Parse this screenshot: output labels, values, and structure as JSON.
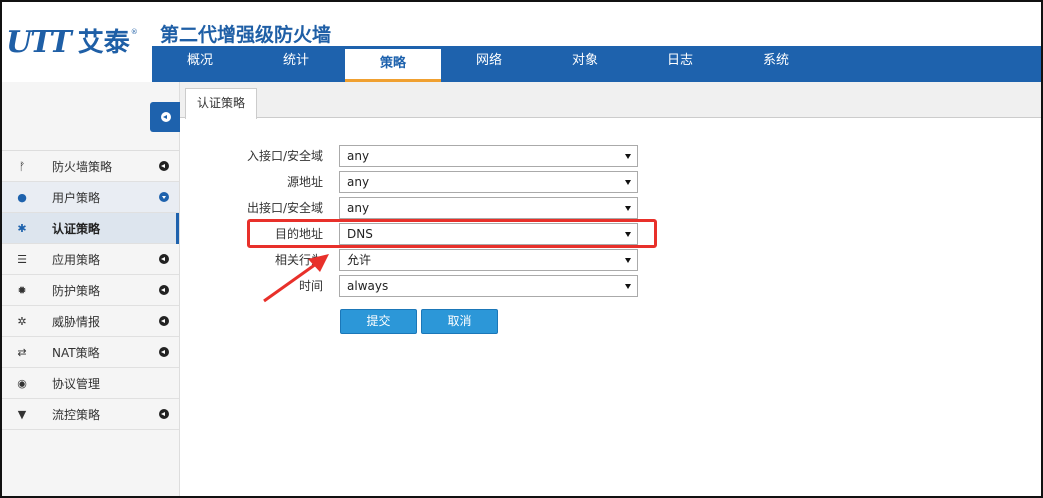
{
  "header": {
    "logo_mark": "UTT",
    "logo_text": "艾泰",
    "logo_reg": "®",
    "product_title": "第二代增强级防火墙"
  },
  "top_nav": {
    "tabs": [
      {
        "label": "概况"
      },
      {
        "label": "统计"
      },
      {
        "label": "策略"
      },
      {
        "label": "网络"
      },
      {
        "label": "对象"
      },
      {
        "label": "日志"
      },
      {
        "label": "系统"
      }
    ],
    "active": "策略"
  },
  "sidebar": {
    "collapse_icon": "chevron-left-circle-icon",
    "items": [
      {
        "label": "防火墙策略",
        "icon": "firewall-icon"
      },
      {
        "label": "用户策略",
        "icon": "users-icon"
      },
      {
        "label": "认证策略",
        "icon": "gear-icon"
      },
      {
        "label": "应用策略",
        "icon": "list-icon"
      },
      {
        "label": "防护策略",
        "icon": "shield-icon"
      },
      {
        "label": "威胁情报",
        "icon": "bug-icon"
      },
      {
        "label": "NAT策略",
        "icon": "exchange-icon"
      },
      {
        "label": "协议管理",
        "icon": "globe-icon"
      },
      {
        "label": "流控策略",
        "icon": "filter-icon"
      }
    ],
    "selected": "认证策略"
  },
  "content": {
    "tab_label": "认证策略",
    "form": {
      "fields": [
        {
          "label": "入接口/安全域",
          "value": "any"
        },
        {
          "label": "源地址",
          "value": "any"
        },
        {
          "label": "出接口/安全域",
          "value": "any"
        },
        {
          "label": "目的地址",
          "value": "DNS"
        },
        {
          "label": "相关行为",
          "value": "允许"
        },
        {
          "label": "时间",
          "value": "always"
        }
      ]
    },
    "buttons": {
      "submit": "提交",
      "cancel": "取消"
    }
  },
  "colors": {
    "brand_blue": "#1e62ad",
    "button_blue": "#2c97d8",
    "annotation_red": "#e8302a",
    "active_tab_underline": "#f0a030"
  }
}
